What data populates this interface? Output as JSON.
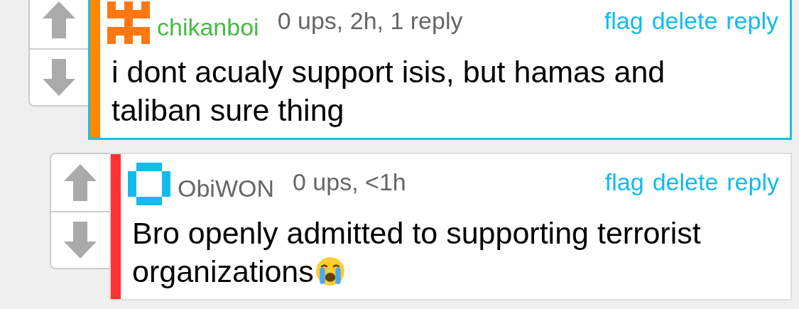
{
  "comments": [
    {
      "user": {
        "name": "chikanboi",
        "color": "#44bb44"
      },
      "avatar": {
        "kind": "cross",
        "color": "#ff7711"
      },
      "meta": "0 ups, 2h, 1 reply",
      "actions": [
        "flag",
        "delete",
        "reply"
      ],
      "body": "i dont acualy support isis, but hamas and taliban sure thing",
      "bar": {
        "color": "#ff8800"
      },
      "highlighted": true,
      "crying_emoji": false
    },
    {
      "user": {
        "name": "ObiWON",
        "color": "#666666"
      },
      "avatar": {
        "kind": "ring",
        "color": "#11bbee"
      },
      "meta": "0 ups, <1h",
      "actions": [
        "flag",
        "delete",
        "reply"
      ],
      "body": "Bro openly admitted to supporting terrorist organizations",
      "bar": {
        "color": "#ff3333"
      },
      "highlighted": false,
      "crying_emoji": true
    }
  ]
}
